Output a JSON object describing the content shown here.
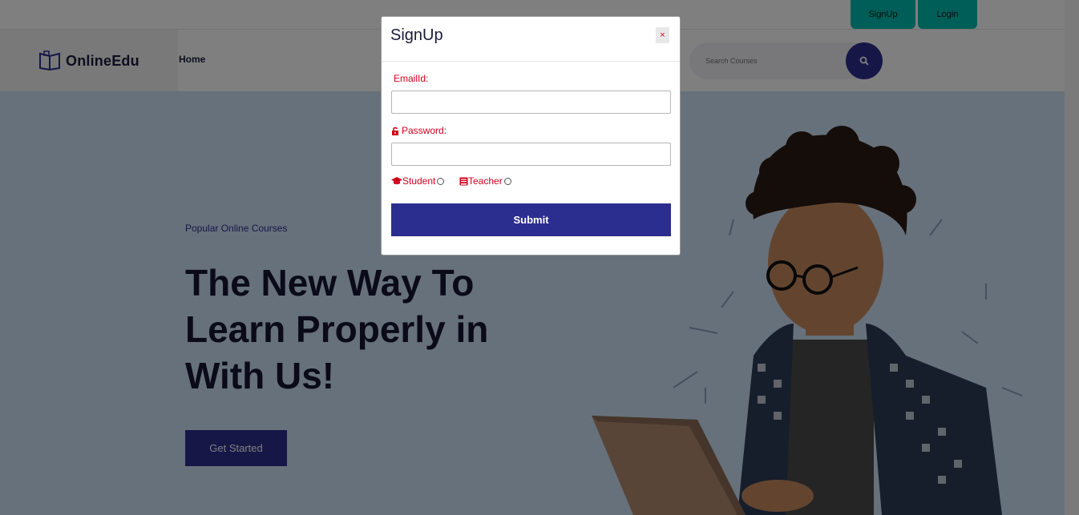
{
  "header": {
    "signup_label": "SignUp",
    "login_label": "Login"
  },
  "nav": {
    "logo_text": "OnlineEdu",
    "home_label": "Home",
    "search_placeholder": "Search Courses"
  },
  "hero": {
    "subtitle": "Popular Online Courses",
    "title": "The New Way To Learn Properly in With Us!",
    "cta_label": "Get Started"
  },
  "modal": {
    "title": "SignUp",
    "close_label": "×",
    "email_label": "EmailId:",
    "password_label": "Password:",
    "student_label": "Student",
    "teacher_label": "Teacher",
    "submit_label": "Submit"
  },
  "colors": {
    "accent": "#2c2e8f",
    "teal": "#00bdb3",
    "label_red": "#d0021b",
    "hero_bg": "#cfe3f6"
  },
  "icons": {
    "logo": "book-icon",
    "search": "search-icon",
    "password": "unlock-icon",
    "student": "graduation-cap-icon",
    "teacher": "book-icon"
  }
}
